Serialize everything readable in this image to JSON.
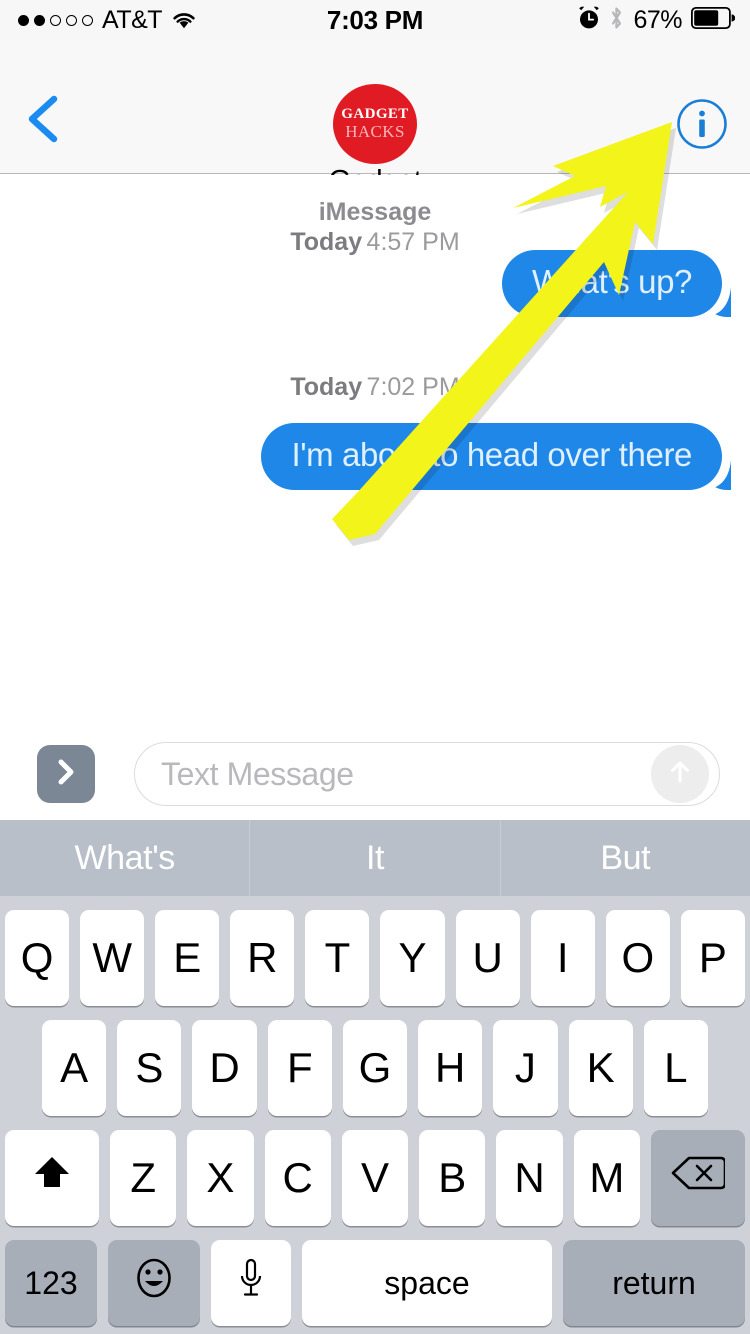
{
  "status_bar": {
    "carrier": "AT&T",
    "signal_dots_filled": 2,
    "signal_dots_total": 5,
    "wifi_icon": "wifi-icon",
    "time": "7:03 PM",
    "alarm_icon": "alarm-clock-icon",
    "bluetooth_icon": "bluetooth-icon",
    "battery_percent": "67%",
    "battery_level": 67
  },
  "nav_bar": {
    "back_icon": "chevron-left-icon",
    "info_icon": "info-circle-icon",
    "avatar": {
      "name": "avatar",
      "line1": "GADGET",
      "line2": "HACKS",
      "color": "#e01b24"
    },
    "contact_name": "Gadget"
  },
  "conversation": {
    "messages": [
      {
        "service": "iMessage",
        "day": "Today",
        "time": "4:57 PM",
        "text": "What's up?",
        "direction": "outgoing"
      },
      {
        "service": "",
        "day": "Today",
        "time": "7:02 PM",
        "text": "I'm about to head over there",
        "direction": "outgoing"
      }
    ],
    "bubble_color": "#1f87e8",
    "bubble_text_color": "#dff0ff"
  },
  "composer": {
    "expand_icon": "chevron-right-icon",
    "placeholder": "Text Message",
    "value": "",
    "send_icon": "arrow-up-circle-icon"
  },
  "predictive_bar": {
    "suggestions": [
      "What's",
      "It",
      "But"
    ],
    "background": "#b9bfc8"
  },
  "keyboard": {
    "row1": [
      "Q",
      "W",
      "E",
      "R",
      "T",
      "Y",
      "U",
      "I",
      "O",
      "P"
    ],
    "row2": [
      "A",
      "S",
      "D",
      "F",
      "G",
      "H",
      "J",
      "K",
      "L"
    ],
    "row3_letters": [
      "Z",
      "X",
      "C",
      "V",
      "B",
      "N",
      "M"
    ],
    "shift_icon": "shift-arrow-up-icon",
    "delete_icon": "backspace-delete-icon",
    "numbers_label": "123",
    "emoji_icon": "smiley-face-icon",
    "dictation_icon": "microphone-icon",
    "space_label": "space",
    "return_label": "return"
  },
  "annotation": {
    "arrow_color": "#f2f41a",
    "arrow_name": "highlight-arrow-pointing-to-info-button"
  }
}
